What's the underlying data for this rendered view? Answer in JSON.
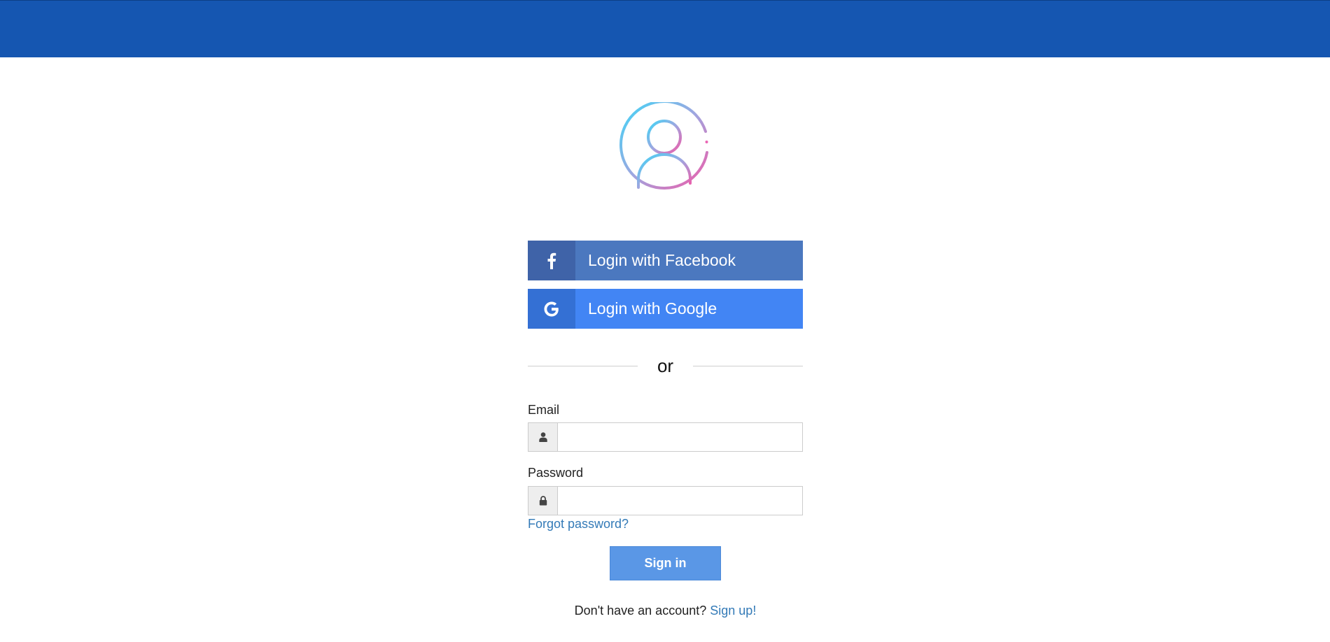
{
  "header": {
    "bar_color": "#1556b1"
  },
  "avatar": {
    "icon": "user-circle-gradient-icon"
  },
  "social": {
    "facebook": {
      "icon": "facebook-icon",
      "label": "Login with Facebook",
      "color": "#4b78bf"
    },
    "google": {
      "icon": "google-icon",
      "label": "Login with Google",
      "color": "#4285f4"
    }
  },
  "divider": {
    "text": "or"
  },
  "form": {
    "email": {
      "label": "Email",
      "value": "",
      "icon": "user-icon"
    },
    "password": {
      "label": "Password",
      "value": "",
      "icon": "lock-icon"
    },
    "forgot_link": "Forgot password?",
    "signin_label": "Sign in"
  },
  "footer": {
    "prompt": "Don't have an account?",
    "signup_link": "Sign up!"
  }
}
